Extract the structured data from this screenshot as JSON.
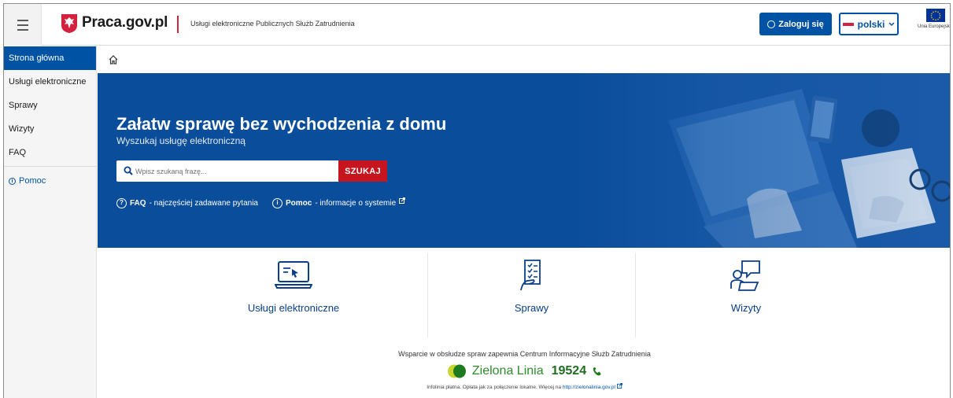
{
  "header": {
    "logo_text": "Praca.gov.pl",
    "subtitle": "Usługi elektroniczne Publicznych Służb Zatrudnienia",
    "login_label": "Zaloguj się",
    "language_label": "polski",
    "eu_label": "Unia Europejska"
  },
  "sidebar": {
    "items": [
      {
        "label": "Strona główna"
      },
      {
        "label": "Usługi elektroniczne"
      },
      {
        "label": "Sprawy"
      },
      {
        "label": "Wizyty"
      },
      {
        "label": "FAQ"
      }
    ],
    "help_label": "Pomoc"
  },
  "hero": {
    "title": "Załatw sprawę bez wychodzenia z domu",
    "subtitle": "Wyszukaj usługę elektroniczną",
    "search_placeholder": "Wpisz szukaną frazę...",
    "search_button": "SZUKAJ",
    "faq_bold": "FAQ",
    "faq_text": " - najczęściej zadawane pytania",
    "help_bold": "Pomoc",
    "help_text": " - informacje o systemie"
  },
  "tiles": [
    {
      "label": "Usługi elektroniczne",
      "icon": "laptop-icon"
    },
    {
      "label": "Sprawy",
      "icon": "document-checklist-icon"
    },
    {
      "label": "Wizyty",
      "icon": "visit-chat-icon"
    }
  ],
  "support": {
    "text": "Wsparcie w obsłudze spraw zapewnia Centrum Informacyjne Służb Zatrudnienia",
    "line_name": "Zielona Linia",
    "line_number": "19524",
    "infolinia_text": "Infolinia płatna. Opłata jak za połączenie lokalne. Więcej na ",
    "infolinia_link": "http://zielonalinia.gov.pl"
  },
  "colors": {
    "brand_blue": "#0052a5",
    "hero_blue": "#0a4d9a",
    "search_red": "#c6151e",
    "green": "#2e8b2e"
  }
}
